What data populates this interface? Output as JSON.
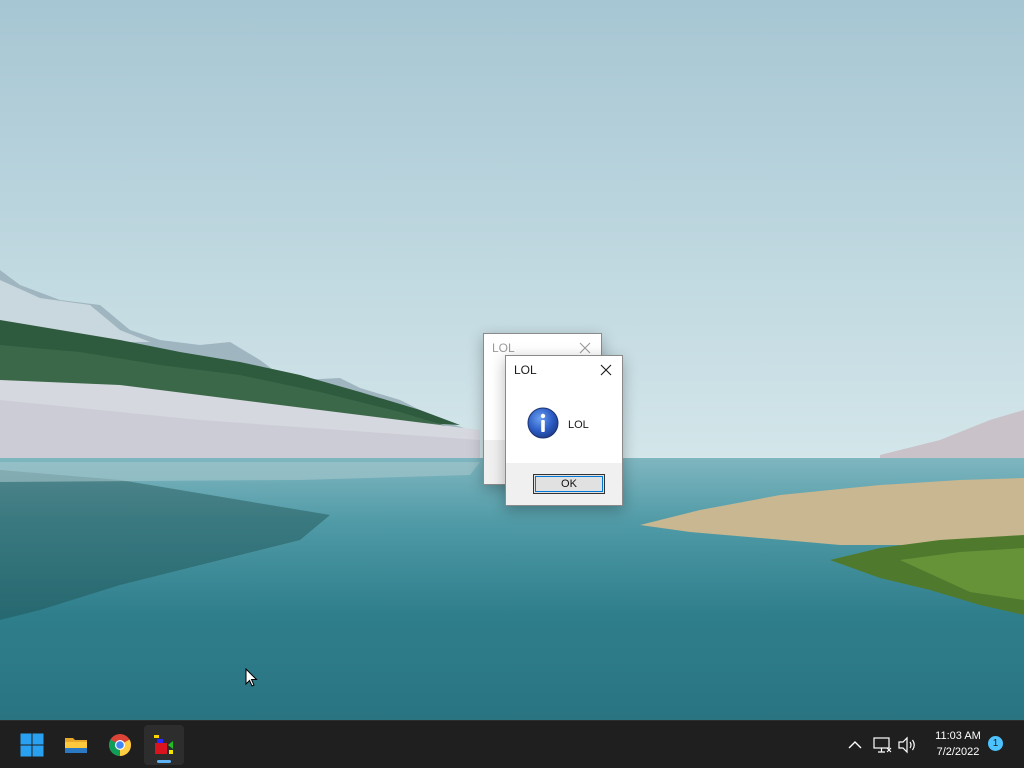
{
  "desktop": {
    "wallpaper": "lake-landscape"
  },
  "dialogs": [
    {
      "title": "LOL",
      "state": "inactive",
      "close_icon": "close-icon"
    },
    {
      "title": "LOL",
      "state": "active",
      "message": "LOL",
      "icon": "info-icon",
      "ok_label": "OK",
      "close_icon": "close-icon"
    }
  ],
  "taskbar": {
    "pinned": [
      {
        "name": "Start",
        "icon": "windows-start-icon"
      },
      {
        "name": "File Explorer",
        "icon": "folder-icon"
      },
      {
        "name": "Google Chrome",
        "icon": "chrome-icon"
      },
      {
        "name": "Running app",
        "icon": "app-icon",
        "active": true
      }
    ],
    "tray": {
      "icons": [
        "chevron-up-icon",
        "network-icon",
        "volume-icon"
      ],
      "time": "11:03 AM",
      "date": "7/2/2022",
      "notification_count": "1"
    },
    "accent": "#4cc2ff"
  }
}
